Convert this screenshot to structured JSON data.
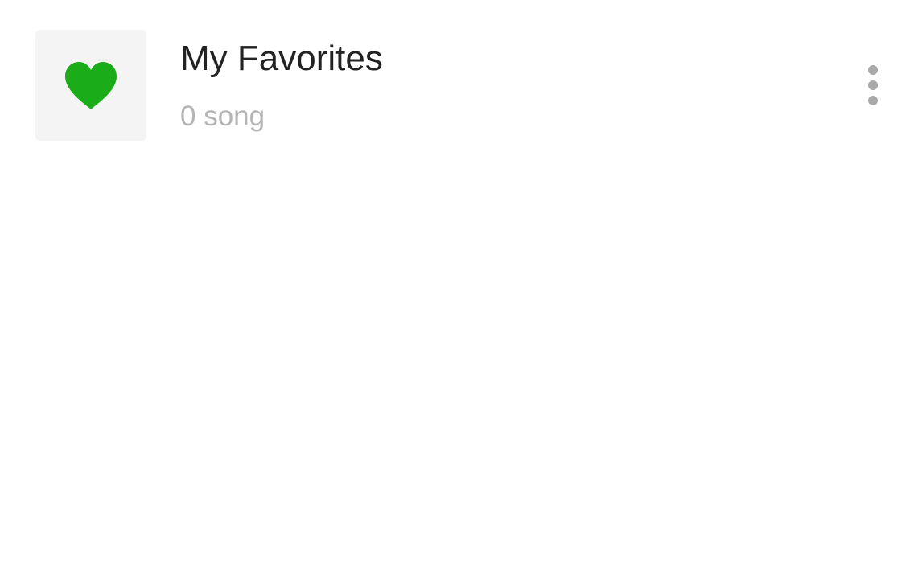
{
  "playlist": {
    "title": "My Favorites",
    "count_label": "0 song",
    "icon": "heart-icon",
    "icon_color": "#1aad19",
    "cover_background": "#f4f4f4"
  },
  "menu": {
    "icon": "more-vertical-icon"
  }
}
